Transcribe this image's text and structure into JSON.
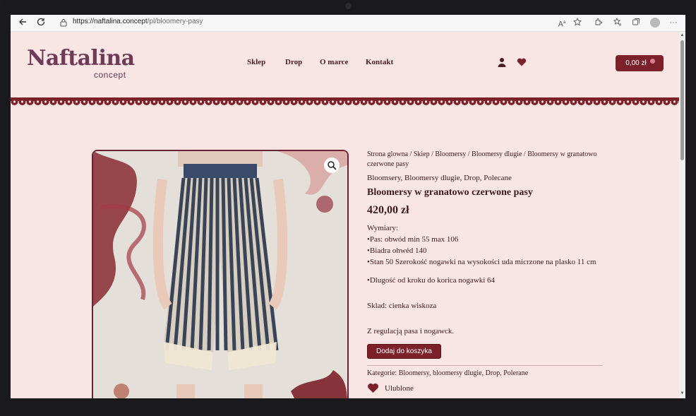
{
  "browser": {
    "url_host": "https://naftalina.concept",
    "url_path": "/pl/bloomery-pasy"
  },
  "header": {
    "logo_main": "Naftalina",
    "logo_sub": "concept",
    "nav": [
      "Sklep",
      "Drop",
      "O marce",
      "Kontakt"
    ],
    "cart_label": "0,00 zł"
  },
  "product": {
    "breadcrumb": "Strona glowna / Skiep / Bloomersy / Bloomersy dlugie / Bloomersy w granatowo czerwone pasy",
    "categories_top": "Bloomsery, Bloomersy dlugie, Drop, Polecane",
    "title": "Bloomersy w granatowo czerwone pasy",
    "price": "420,00 zł",
    "dims_heading": "Wymiary:",
    "dims": [
      "•Pas: obwód min 55 max 106",
      "•Biadra ohwéd 140",
      "•Stan 50 Szerokość nogawki na wysokości uda micrzone na plasko 11 cm"
    ],
    "length": "•Dlugość od kroku do korica nogawki 64",
    "composition": "Sklad: cienka wiskoza",
    "regulation": "Z regulacją pasa i nogawck.",
    "add_button": "Dodaj do koszyka",
    "categories_bottom": "Kategorie: Bloomersy, bloomersy dlugie, Drop, Polerane",
    "favorite": "Ulublone"
  },
  "colors": {
    "page_bg": "#f8e5e4",
    "accent": "#7c2029",
    "logo": "#6f3a56"
  }
}
